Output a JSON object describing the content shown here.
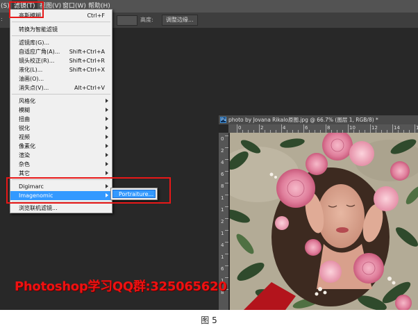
{
  "menubar": {
    "cut_prefix": "(S)",
    "filter": "滤镜(T)",
    "view": "视图(V)",
    "window": "窗口(W)",
    "help": "帮助(H)"
  },
  "options_bar": {
    "height_label": "高度:",
    "refine_edge_button": "调整边缘..."
  },
  "filter_menu": {
    "items": [
      {
        "label": "高斯模糊",
        "shortcut": "Ctrl+F"
      },
      {
        "label": "转换为智能滤镜",
        "shortcut": ""
      },
      {
        "label": "滤镜库(G)...",
        "shortcut": ""
      },
      {
        "label": "自适应广角(A)...",
        "shortcut": "Shift+Ctrl+A"
      },
      {
        "label": "镜头校正(R)...",
        "shortcut": "Shift+Ctrl+R"
      },
      {
        "label": "液化(L)...",
        "shortcut": "Shift+Ctrl+X"
      },
      {
        "label": "油画(O)...",
        "shortcut": ""
      },
      {
        "label": "消失点(V)...",
        "shortcut": "Alt+Ctrl+V"
      },
      {
        "label": "风格化",
        "shortcut": ""
      },
      {
        "label": "模糊",
        "shortcut": ""
      },
      {
        "label": "扭曲",
        "shortcut": ""
      },
      {
        "label": "锐化",
        "shortcut": ""
      },
      {
        "label": "视频",
        "shortcut": ""
      },
      {
        "label": "像素化",
        "shortcut": ""
      },
      {
        "label": "渲染",
        "shortcut": ""
      },
      {
        "label": "杂色",
        "shortcut": ""
      },
      {
        "label": "其它",
        "shortcut": ""
      },
      {
        "label": "Digimarc",
        "shortcut": ""
      },
      {
        "label": "Imagenomic",
        "shortcut": ""
      },
      {
        "label": "浏览联机滤镜...",
        "shortcut": ""
      }
    ]
  },
  "submenu": {
    "portraiture": "Portraiture..."
  },
  "document": {
    "ps_icon": "Ps",
    "title": "photo by Jovana Rikalo原图.jpg @ 66.7% (图层 1, RGB/8) *",
    "ruler_h": [
      "0",
      "2",
      "4",
      "6",
      "8",
      "10",
      "12",
      "14",
      "16"
    ],
    "ruler_v": [
      "0",
      "2",
      "4",
      "6",
      "8",
      "1",
      "1",
      "2",
      "1",
      "4",
      "1",
      "6",
      "1",
      "8"
    ]
  },
  "watermark": "Photoshop学习QQ群:325065620",
  "caption": "图 5",
  "colors": {
    "highlight": "#3399ff",
    "annotation_red": "#e81818",
    "watermark_red": "#ee1111"
  }
}
